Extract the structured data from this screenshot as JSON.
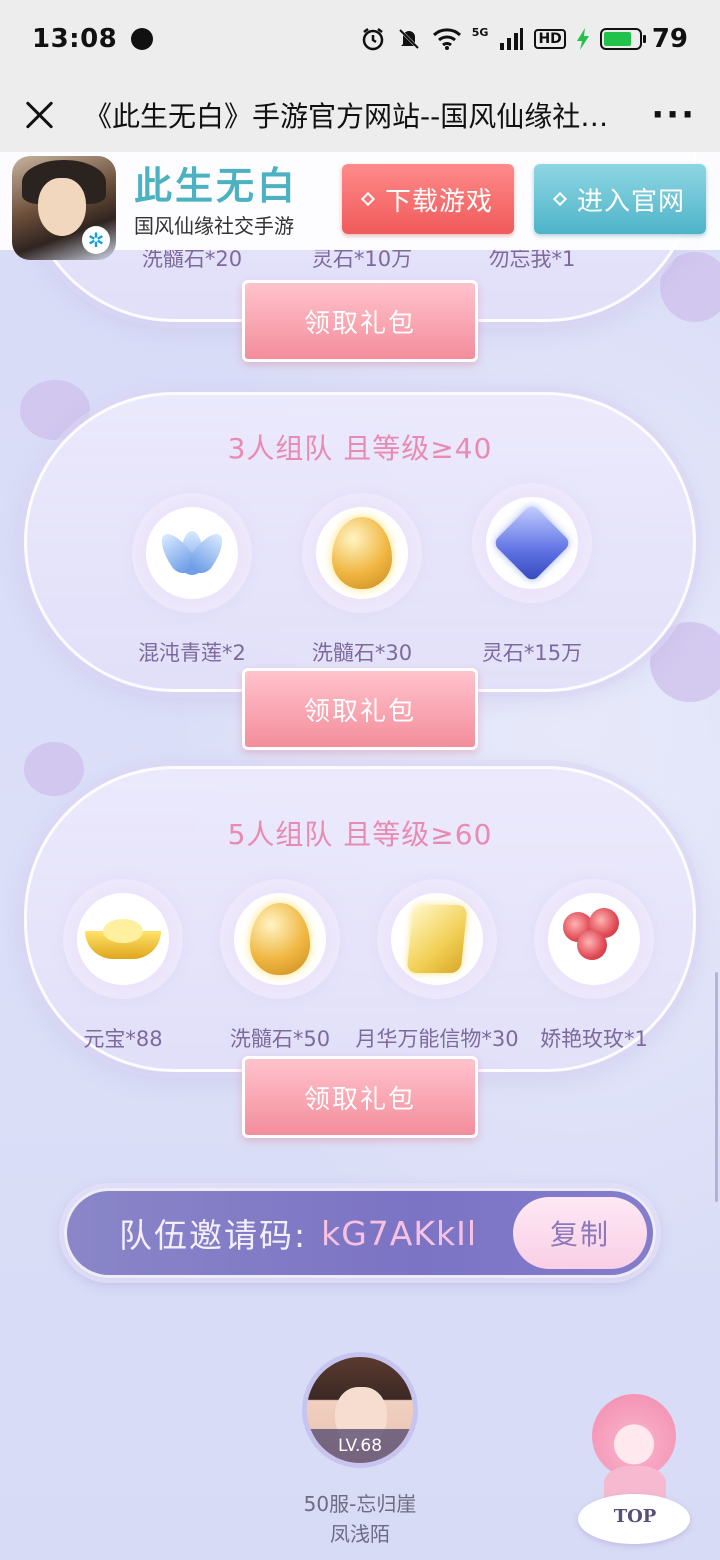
{
  "status_bar": {
    "time": "13:08",
    "battery_level": "79",
    "network": "5G",
    "hd": "HD",
    "icons": [
      "alarm-icon",
      "mute-icon",
      "wifi-icon",
      "signal-icon",
      "hd-icon",
      "charging-icon",
      "battery-icon"
    ]
  },
  "title_bar": {
    "title": "《此生无白》手游官方网站--国风仙缘社…",
    "more": "···"
  },
  "banner": {
    "app_name": "此生无白",
    "app_subtitle": "国风仙缘社交手游",
    "download_label": "下载游戏",
    "official_label": "进入官网",
    "download_color": "#f05a5a",
    "official_color": "#4db4c8"
  },
  "panel1": {
    "items": [
      {
        "label": "洗髓石*20"
      },
      {
        "label": "灵石*10万"
      },
      {
        "label": "勿忘我*1"
      }
    ],
    "claim_label": "领取礼包"
  },
  "panel2": {
    "title": "3人组队 且等级≥40",
    "items": [
      {
        "label": "混沌青莲*2",
        "icon": "lotus-icon"
      },
      {
        "label": "洗髓石*30",
        "icon": "marrow-stone-icon"
      },
      {
        "label": "灵石*15万",
        "icon": "spirit-stone-icon"
      }
    ],
    "claim_label": "领取礼包"
  },
  "panel3": {
    "title": "5人组队 且等级≥60",
    "items": [
      {
        "label": "元宝*88",
        "icon": "gold-ingot-icon"
      },
      {
        "label": "洗髓石*50",
        "icon": "marrow-stone-icon"
      },
      {
        "label": "月华万能信物*30",
        "icon": "token-icon"
      },
      {
        "label": "娇艳玫玫*1",
        "icon": "rose-icon"
      }
    ],
    "claim_label": "领取礼包"
  },
  "invite": {
    "label": "队伍邀请码:",
    "code": "kG7AKkIl",
    "copy_label": "复制"
  },
  "player": {
    "level": "LV.68",
    "server": "50服-忘归崖",
    "name": "凤浅陌"
  },
  "top_button": {
    "label": "TOP"
  },
  "colors": {
    "title_pink": "#e98ab2",
    "item_text": "#7d6a9c",
    "background": "#d9dcf6"
  }
}
